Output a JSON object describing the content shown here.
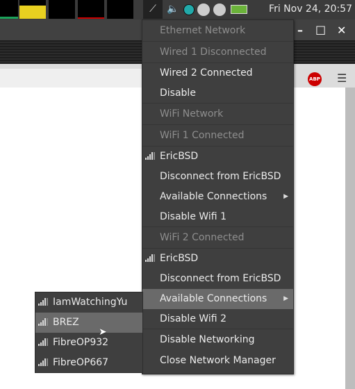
{
  "panel": {
    "clock": "Fri Nov 24, 20:57",
    "tray_icons": [
      "network-plug-icon",
      "volume-icon",
      "update-icon",
      "drive-icon",
      "drive-icon",
      "battery-icon"
    ]
  },
  "window": {
    "minimize": "–",
    "maximize": "□",
    "close": "✕",
    "adblock": "ABP",
    "menu": "☰"
  },
  "menu": {
    "ethernet_header": "Ethernet Network",
    "wired1": "Wired 1 Disconnected",
    "wired2": "Wired 2 Connected",
    "disable": "Disable",
    "wifi_header": "WiFi Network",
    "wifi1_status": "WiFi 1 Connected",
    "wifi1_ssid": "EricBSD",
    "wifi1_disconnect": "Disconnect from EricBSD",
    "wifi1_available": "Available Connections",
    "wifi1_disable": "Disable Wifi 1",
    "wifi2_status": "WiFi 2 Connected",
    "wifi2_ssid": "EricBSD",
    "wifi2_disconnect": "Disconnect from EricBSD",
    "wifi2_available": "Available Connections",
    "wifi2_disable": "Disable Wifi 2",
    "disable_networking": "Disable Networking",
    "close": "Close Network Manager"
  },
  "submenu": {
    "networks": [
      "IamWatchingYu",
      "BREZ",
      "FibreOP932",
      "FibreOP667"
    ],
    "highlighted": "BREZ"
  }
}
